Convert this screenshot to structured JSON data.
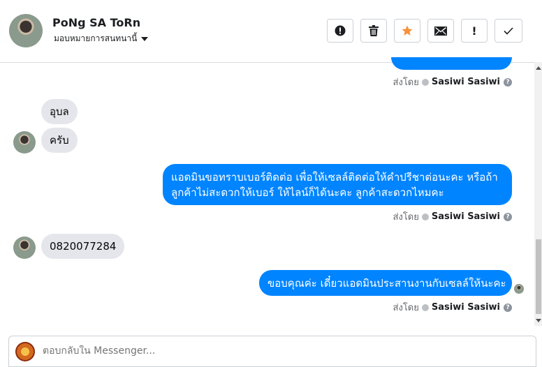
{
  "header": {
    "contact_name": "PoNg SA ToRn",
    "assign_label": "มอบหมายการสนทนานี้",
    "toolbar": {
      "spam": "!",
      "delete": "trash-icon",
      "star": "★",
      "mail": "envelope-icon",
      "important": "!",
      "done": "✓"
    }
  },
  "colors": {
    "accent": "#0084ff",
    "star": "#f7923a",
    "bubble_in": "#e4e6eb"
  },
  "messages": {
    "sender_prefix": "ส่งโดย",
    "sender_name": "Sasiwi Sasiwi",
    "help": "?",
    "in1": "อุบล",
    "in2": "ครับ",
    "out1_line1": "แอดมินขอทราบเบอร์ติดต่อ เพื่อให้เซลล์ติดต่อให้คำปรีชาต่อนะคะ หรือถ้า",
    "out1_line2": "ลูกค้าไม่สะดวกให้เบอร์ ให้ไลน์ก็ได้นะคะ ลูกค้าสะดวกไหมคะ",
    "in3": "0820077284",
    "out2": "ขอบคุณค่ะ เดี๋ยวแอดมินประสานงานกับเซลล์ให้นะคะ"
  },
  "composer": {
    "placeholder": "ตอบกลับใน Messenger..."
  }
}
